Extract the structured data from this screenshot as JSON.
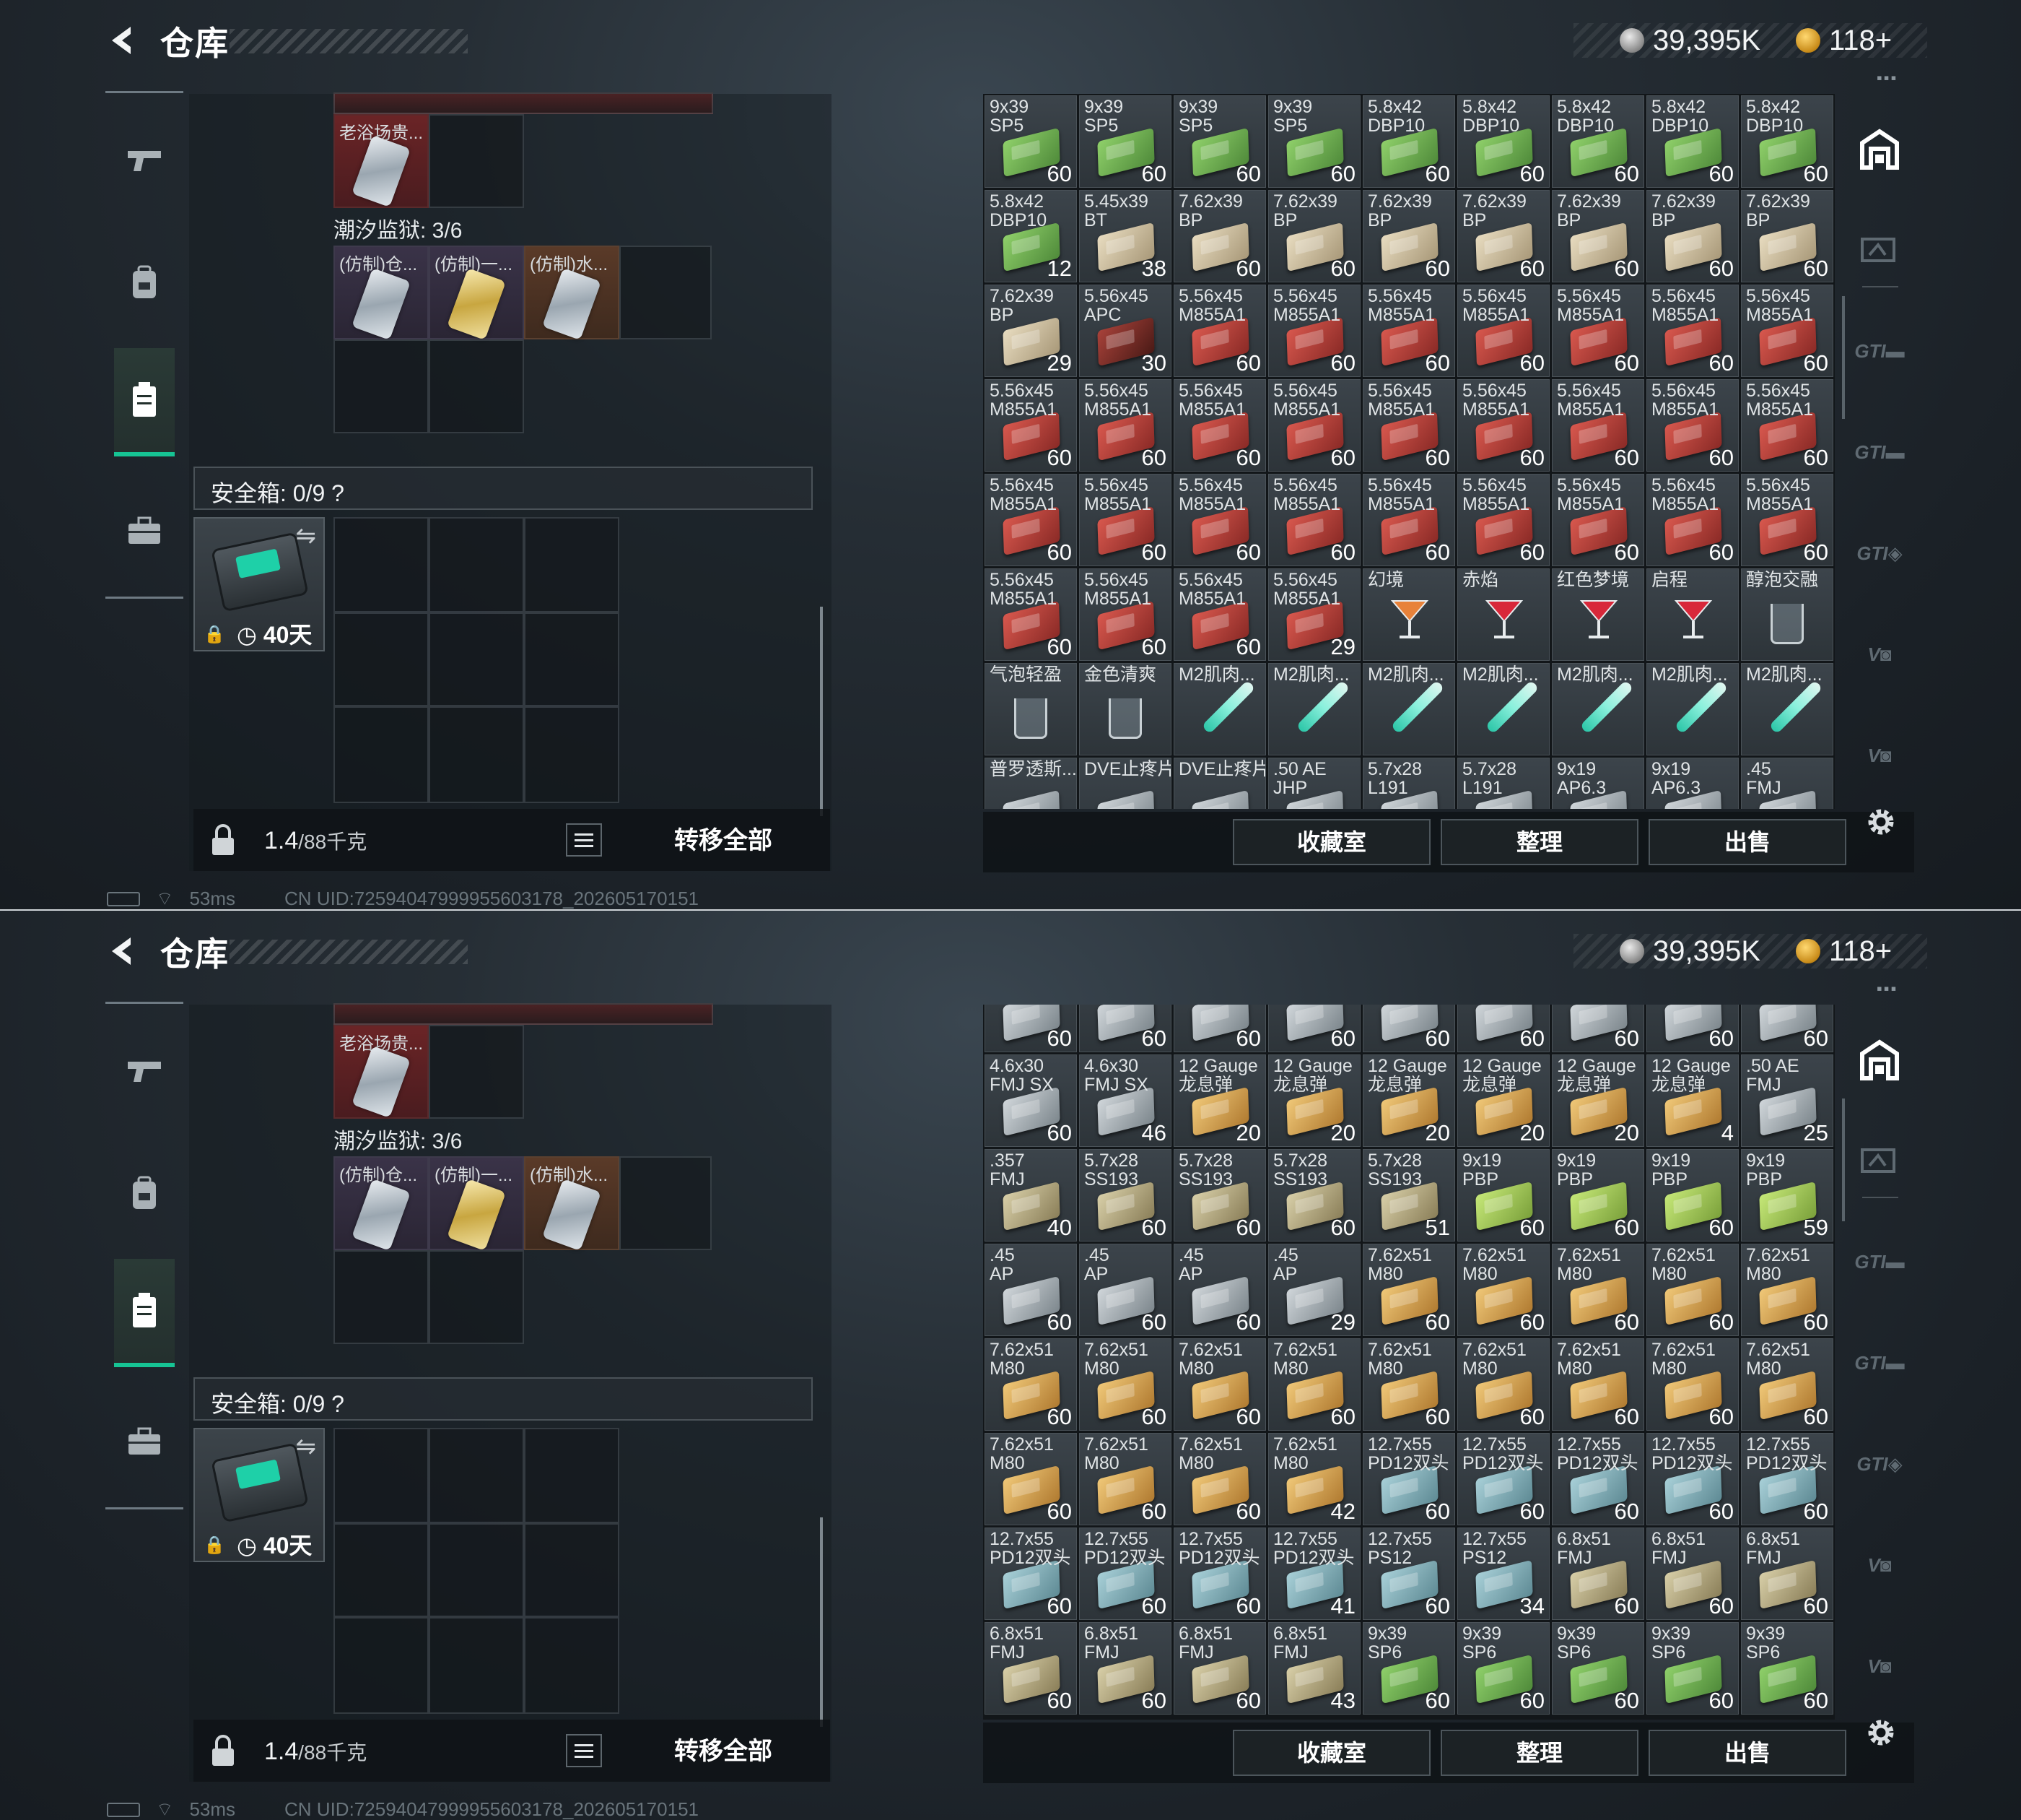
{
  "header": {
    "title": "仓库",
    "silver": "39,395K",
    "gold": "118+"
  },
  "nav": {
    "items": [
      "weapon-nav",
      "backpack-nav",
      "storage-nav",
      "case-nav"
    ]
  },
  "left": {
    "item_top_label": "老浴场贵...",
    "section_label": "潮汐监狱: 3/6",
    "cells": [
      "(仿制)仓...",
      "(仿制)一...",
      "(仿制)水..."
    ],
    "safe_label": "安全箱: 0/9",
    "safe_help": "?",
    "safe_timer": "40天",
    "weight_value": "1.4",
    "weight_unit": "/88千克",
    "transfer_label": "转移全部"
  },
  "status": {
    "ping": "53ms",
    "uid": "CN UID:72594047999955603178_202605170151"
  },
  "actions": {
    "collection": "收藏室",
    "sort": "整理",
    "sell": "出售"
  },
  "panels": [
    {
      "grid": [
        [
          [
            "9x39\nSP5",
            "60",
            "green"
          ],
          [
            "9x39\nSP5",
            "60",
            "green"
          ],
          [
            "9x39\nSP5",
            "60",
            "green"
          ],
          [
            "9x39\nSP5",
            "60",
            "green"
          ],
          [
            "5.8x42\nDBP10",
            "60",
            "green"
          ],
          [
            "5.8x42\nDBP10",
            "60",
            "green"
          ],
          [
            "5.8x42\nDBP10",
            "60",
            "green"
          ],
          [
            "5.8x42\nDBP10",
            "60",
            "green"
          ],
          [
            "5.8x42\nDBP10",
            "60",
            "green"
          ]
        ],
        [
          [
            "5.8x42\nDBP10",
            "12",
            "green"
          ],
          [
            "5.45x39\nBT",
            "38",
            "tan"
          ],
          [
            "7.62x39\nBP",
            "60",
            "tan"
          ],
          [
            "7.62x39\nBP",
            "60",
            "tan"
          ],
          [
            "7.62x39\nBP",
            "60",
            "tan"
          ],
          [
            "7.62x39\nBP",
            "60",
            "tan"
          ],
          [
            "7.62x39\nBP",
            "60",
            "tan"
          ],
          [
            "7.62x39\nBP",
            "60",
            "tan"
          ],
          [
            "7.62x39\nBP",
            "60",
            "tan"
          ]
        ],
        [
          [
            "7.62x39\nBP",
            "29",
            "tan"
          ],
          [
            "5.56x45\nAPC",
            "30",
            "darkred"
          ],
          [
            "5.56x45\nM855A1",
            "60",
            "red"
          ],
          [
            "5.56x45\nM855A1",
            "60",
            "red"
          ],
          [
            "5.56x45\nM855A1",
            "60",
            "red"
          ],
          [
            "5.56x45\nM855A1",
            "60",
            "red"
          ],
          [
            "5.56x45\nM855A1",
            "60",
            "red"
          ],
          [
            "5.56x45\nM855A1",
            "60",
            "red"
          ],
          [
            "5.56x45\nM855A1",
            "60",
            "red"
          ]
        ],
        [
          [
            "5.56x45\nM855A1",
            "60",
            "red"
          ],
          [
            "5.56x45\nM855A1",
            "60",
            "red"
          ],
          [
            "5.56x45\nM855A1",
            "60",
            "red"
          ],
          [
            "5.56x45\nM855A1",
            "60",
            "red"
          ],
          [
            "5.56x45\nM855A1",
            "60",
            "red"
          ],
          [
            "5.56x45\nM855A1",
            "60",
            "red"
          ],
          [
            "5.56x45\nM855A1",
            "60",
            "red"
          ],
          [
            "5.56x45\nM855A1",
            "60",
            "red"
          ],
          [
            "5.56x45\nM855A1",
            "60",
            "red"
          ]
        ],
        [
          [
            "5.56x45\nM855A1",
            "60",
            "red"
          ],
          [
            "5.56x45\nM855A1",
            "60",
            "red"
          ],
          [
            "5.56x45\nM855A1",
            "60",
            "red"
          ],
          [
            "5.56x45\nM855A1",
            "60",
            "red"
          ],
          [
            "5.56x45\nM855A1",
            "60",
            "red"
          ],
          [
            "5.56x45\nM855A1",
            "60",
            "red"
          ],
          [
            "5.56x45\nM855A1",
            "60",
            "red"
          ],
          [
            "5.56x45\nM855A1",
            "60",
            "red"
          ],
          [
            "5.56x45\nM855A1",
            "60",
            "red"
          ]
        ],
        [
          [
            "5.56x45\nM855A1",
            "60",
            "red"
          ],
          [
            "5.56x45\nM855A1",
            "60",
            "red"
          ],
          [
            "5.56x45\nM855A1",
            "60",
            "red"
          ],
          [
            "5.56x45\nM855A1",
            "29",
            "red"
          ],
          [
            "幻境",
            "",
            "cocktail-orange"
          ],
          [
            "赤焰",
            "",
            "cocktail-red"
          ],
          [
            "红色梦境",
            "",
            "cocktail-red"
          ],
          [
            "启程",
            "",
            "cocktail-red"
          ],
          [
            "醇泡交融",
            "",
            "glass"
          ]
        ],
        [
          [
            "气泡轻盈",
            "",
            "glass"
          ],
          [
            "金色清爽",
            "",
            "glass"
          ],
          [
            "M2肌肉...",
            "",
            "syringe"
          ],
          [
            "M2肌肉...",
            "",
            "syringe"
          ],
          [
            "M2肌肉...",
            "",
            "syringe"
          ],
          [
            "M2肌肉...",
            "",
            "syringe"
          ],
          [
            "M2肌肉...",
            "",
            "syringe"
          ],
          [
            "M2肌肉...",
            "",
            "syringe"
          ],
          [
            "M2肌肉...",
            "",
            "syringe"
          ]
        ],
        [
          [
            "普罗透斯...",
            "",
            "gray"
          ],
          [
            "DVE止疼片",
            "",
            "gray"
          ],
          [
            "DVE止疼片",
            "",
            "gray"
          ],
          [
            ".50 AE\nJHP",
            "",
            "gray"
          ],
          [
            "5.7x28\nL191",
            "",
            "gray"
          ],
          [
            "5.7x28\nL191",
            "",
            "gray"
          ],
          [
            "9x19\nAP6.3",
            "",
            "gray"
          ],
          [
            "9x19\nAP6.3",
            "",
            "gray"
          ],
          [
            ".45\nFMJ",
            "",
            "gray"
          ]
        ]
      ]
    },
    {
      "grid": [
        [
          [
            "",
            "60",
            "gray"
          ],
          [
            "",
            "60",
            "gray"
          ],
          [
            "",
            "60",
            "gray"
          ],
          [
            "",
            "60",
            "gray"
          ],
          [
            "",
            "60",
            "gray"
          ],
          [
            "",
            "60",
            "gray"
          ],
          [
            "",
            "60",
            "gray"
          ],
          [
            "",
            "60",
            "gray"
          ],
          [
            "",
            "60",
            "gray"
          ]
        ],
        [
          [
            "4.6x30\nFMJ SX",
            "60",
            "gray"
          ],
          [
            "4.6x30\nFMJ SX",
            "46",
            "gray"
          ],
          [
            "12 Gauge\n龙息弹",
            "20",
            "orange"
          ],
          [
            "12 Gauge\n龙息弹",
            "20",
            "orange"
          ],
          [
            "12 Gauge\n龙息弹",
            "20",
            "orange"
          ],
          [
            "12 Gauge\n龙息弹",
            "20",
            "orange"
          ],
          [
            "12 Gauge\n龙息弹",
            "20",
            "orange"
          ],
          [
            "12 Gauge\n龙息弹",
            "4",
            "orange"
          ],
          [
            ".50 AE\nFMJ",
            "25",
            "gray"
          ]
        ],
        [
          [
            ".357\nFMJ",
            "40",
            "khaki"
          ],
          [
            "5.7x28\nSS193",
            "60",
            "khaki"
          ],
          [
            "5.7x28\nSS193",
            "60",
            "khaki"
          ],
          [
            "5.7x28\nSS193",
            "60",
            "khaki"
          ],
          [
            "5.7x28\nSS193",
            "51",
            "khaki"
          ],
          [
            "9x19\nPBP",
            "60",
            "lime"
          ],
          [
            "9x19\nPBP",
            "60",
            "lime"
          ],
          [
            "9x19\nPBP",
            "60",
            "lime"
          ],
          [
            "9x19\nPBP",
            "59",
            "lime"
          ]
        ],
        [
          [
            ".45\nAP",
            "60",
            "gray"
          ],
          [
            ".45\nAP",
            "60",
            "gray"
          ],
          [
            ".45\nAP",
            "60",
            "gray"
          ],
          [
            ".45\nAP",
            "29",
            "gray"
          ],
          [
            "7.62x51\nM80",
            "60",
            "orange"
          ],
          [
            "7.62x51\nM80",
            "60",
            "orange"
          ],
          [
            "7.62x51\nM80",
            "60",
            "orange"
          ],
          [
            "7.62x51\nM80",
            "60",
            "orange"
          ],
          [
            "7.62x51\nM80",
            "60",
            "orange"
          ]
        ],
        [
          [
            "7.62x51\nM80",
            "60",
            "orange"
          ],
          [
            "7.62x51\nM80",
            "60",
            "orange"
          ],
          [
            "7.62x51\nM80",
            "60",
            "orange"
          ],
          [
            "7.62x51\nM80",
            "60",
            "orange"
          ],
          [
            "7.62x51\nM80",
            "60",
            "orange"
          ],
          [
            "7.62x51\nM80",
            "60",
            "orange"
          ],
          [
            "7.62x51\nM80",
            "60",
            "orange"
          ],
          [
            "7.62x51\nM80",
            "60",
            "orange"
          ],
          [
            "7.62x51\nM80",
            "60",
            "orange"
          ]
        ],
        [
          [
            "7.62x51\nM80",
            "60",
            "orange"
          ],
          [
            "7.62x51\nM80",
            "60",
            "orange"
          ],
          [
            "7.62x51\nM80",
            "60",
            "orange"
          ],
          [
            "7.62x51\nM80",
            "42",
            "orange"
          ],
          [
            "12.7x55\nPD12双头",
            "60",
            "blue"
          ],
          [
            "12.7x55\nPD12双头",
            "60",
            "blue"
          ],
          [
            "12.7x55\nPD12双头",
            "60",
            "blue"
          ],
          [
            "12.7x55\nPD12双头",
            "60",
            "blue"
          ],
          [
            "12.7x55\nPD12双头",
            "60",
            "blue"
          ]
        ],
        [
          [
            "12.7x55\nPD12双头",
            "60",
            "blue"
          ],
          [
            "12.7x55\nPD12双头",
            "60",
            "blue"
          ],
          [
            "12.7x55\nPD12双头",
            "60",
            "blue"
          ],
          [
            "12.7x55\nPD12双头",
            "41",
            "blue"
          ],
          [
            "12.7x55\nPS12",
            "60",
            "blue"
          ],
          [
            "12.7x55\nPS12",
            "34",
            "blue"
          ],
          [
            "6.8x51\nFMJ",
            "60",
            "khaki"
          ],
          [
            "6.8x51\nFMJ",
            "60",
            "khaki"
          ],
          [
            "6.8x51\nFMJ",
            "60",
            "khaki"
          ]
        ],
        [
          [
            "6.8x51\nFMJ",
            "60",
            "khaki"
          ],
          [
            "6.8x51\nFMJ",
            "60",
            "khaki"
          ],
          [
            "6.8x51\nFMJ",
            "60",
            "khaki"
          ],
          [
            "6.8x51\nFMJ",
            "43",
            "khaki"
          ],
          [
            "9x39\nSP6",
            "60",
            "green"
          ],
          [
            "9x39\nSP6",
            "60",
            "green"
          ],
          [
            "9x39\nSP6",
            "60",
            "green"
          ],
          [
            "9x39\nSP6",
            "60",
            "green"
          ],
          [
            "9x39\nSP6",
            "60",
            "green"
          ]
        ]
      ]
    }
  ]
}
